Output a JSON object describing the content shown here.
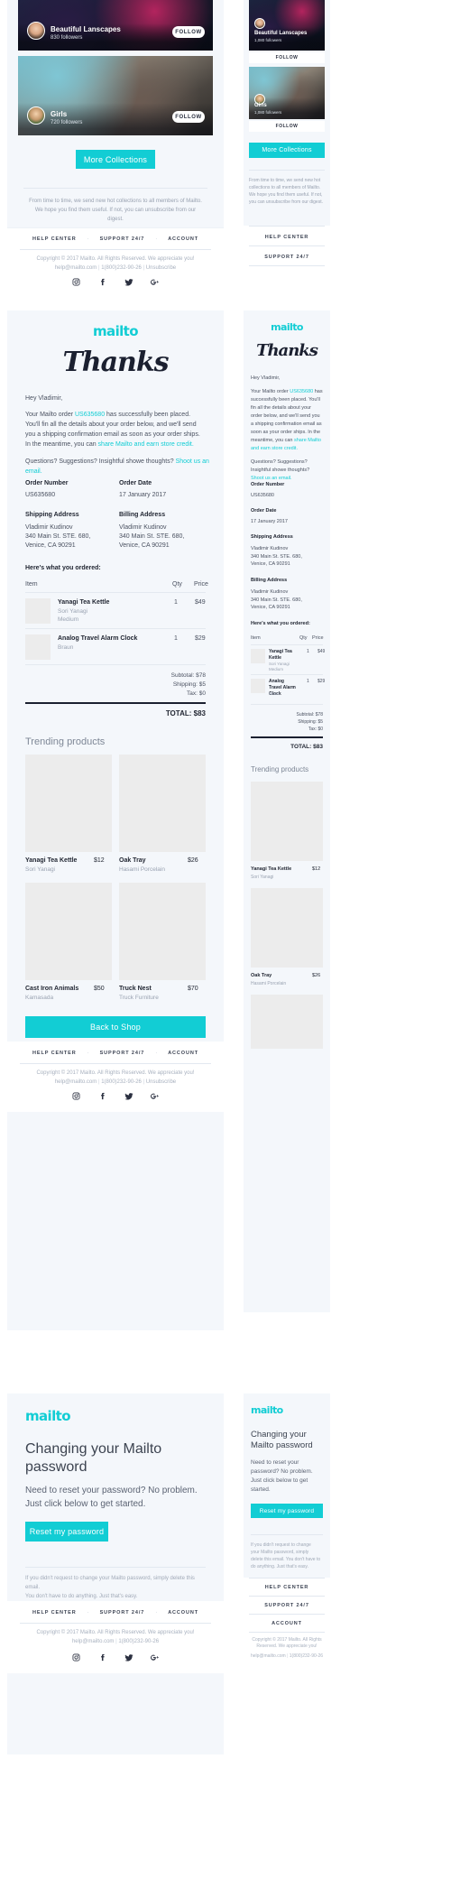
{
  "brand": {
    "name": "mailto",
    "accent": "#12cdd4"
  },
  "email1": {
    "collections": [
      {
        "title": "Beautiful Lanscapes",
        "followers_desktop": "830 followers",
        "followers_mobile": "1,080 followers",
        "follow_label": "FOLLOW",
        "image": "landscape-photo"
      },
      {
        "title": "Girls",
        "followers_desktop": "720 followers",
        "followers_mobile": "1,080 followers",
        "follow_label": "FOLLOW",
        "image": "girls-photo"
      }
    ],
    "cta": "More Collections",
    "note_desktop": "From time to time, we send new hot collections to all members of Mailto. We hope you find them useful. If not, you can unsubscribe from our digest.",
    "note_mobile": "From time to time, we send new hot collections to all members of Mailto. We hope you find them useful. If not, you can unsubscribe from our digest.",
    "note_link": "unsubscribe"
  },
  "email2": {
    "heading_script": "Thanks",
    "greeting": "Hey Vladimir,",
    "body_part1": "Your Mailto order ",
    "order_link": "US635680",
    "body_part2": " has successfully been placed. You'll fin all the details about your order below, and we'll send you a shipping confirmation email as soon as your order ships. In the meantime, you can ",
    "body_link2": "share Mailto and earn store credit.",
    "questions": "Questions? Suggestions? Insightful showe thoughts? ",
    "questions_link": "Shoot us an email.",
    "fields": {
      "order_number_label": "Order Number",
      "order_number_value": "US635680",
      "order_date_label": "Order Date",
      "order_date_value": "17 January 2017",
      "shipping_label": "Shipping Address",
      "billing_label": "Billing Address",
      "address_name": "Vladimir Kudinov",
      "address_line1": "340 Main St. STE. 680,",
      "address_line2": "Venice, CA 90291"
    },
    "ordered_title": "Here's what you ordered:",
    "table_headers": {
      "item": "Item",
      "qty": "Qty",
      "price": "Price"
    },
    "items": [
      {
        "name": "Yanagi Tea Kettle",
        "brand": "Sori Yanagi",
        "variant": "Medium",
        "qty": "1",
        "price": "$49",
        "image": "kettle-photo"
      },
      {
        "name": "Analog Travel Alarm Clock",
        "brand": "Braun",
        "variant": "",
        "qty": "1",
        "price": "$29",
        "image": "clock-photo"
      }
    ],
    "totals": [
      {
        "label": "Subtotal:",
        "value": "$78"
      },
      {
        "label": "Shipping:",
        "value": "$5"
      },
      {
        "label": "Tax:",
        "value": "$0"
      }
    ],
    "grand_total_label": "TOTAL:",
    "grand_total_value": "$83",
    "trending_title": "Trending products",
    "trending": [
      {
        "name": "Yanagi Tea Kettle",
        "brand": "Sori Yanagi",
        "price": "$12",
        "image": "plant-photo"
      },
      {
        "name": "Oak Tray",
        "brand": "Hasami Porcelain",
        "price": "$26",
        "image": "tray-photo"
      },
      {
        "name": "Cast Iron Animals",
        "brand": "Kamasada",
        "price": "$50",
        "image": "bird-photo"
      },
      {
        "name": "Truck Nest",
        "brand": "Truck Furniture",
        "price": "$70",
        "image": "nest-photo"
      }
    ],
    "cta": "Back to Shop"
  },
  "email3": {
    "title_line1": "Changing your Mailto",
    "title_line2": "password",
    "title_mobile_line1": "Changing your",
    "title_mobile_line2": "Mailto password",
    "body_line1": "Need to reset your password? No problem.",
    "body_line2": "Just click below to get started.",
    "body_mobile_line1": "Need to reset your",
    "body_mobile_line2": "password? No problem.",
    "body_mobile_line3": "Just click below to get",
    "body_mobile_line4": "started.",
    "cta": "Reset my password",
    "note_line1": "If you didn't request to change your Mailto password, simply delete this email.",
    "note_line2": "You don't have to do anything. Just that's easy.",
    "note_mobile_line1": "If you didn't request to change",
    "note_mobile_line2": "your Mailto password, simply",
    "note_mobile_line3": "delete this email. You don't have to",
    "note_mobile_line4": "do anything. Just that's easy."
  },
  "footer": {
    "links": [
      "HELP CENTER",
      "SUPPORT 24/7",
      "ACCOUNT"
    ],
    "separator": "·",
    "copyright": "Copyright © 2017 Mailto. All Rights Reserved. We appreciate you!",
    "copyright_mobile_line1": "Copyright © 2017 Mailto. All Rights",
    "copyright_mobile_line2": "Reserved. We appreciate you!",
    "email": "help@mailto.com",
    "phone": "1(800)232-90-26",
    "unsubscribe": "Unsubscribe",
    "pipe": "|",
    "social": [
      "instagram-icon",
      "facebook-icon",
      "twitter-icon",
      "google-plus-icon"
    ]
  }
}
